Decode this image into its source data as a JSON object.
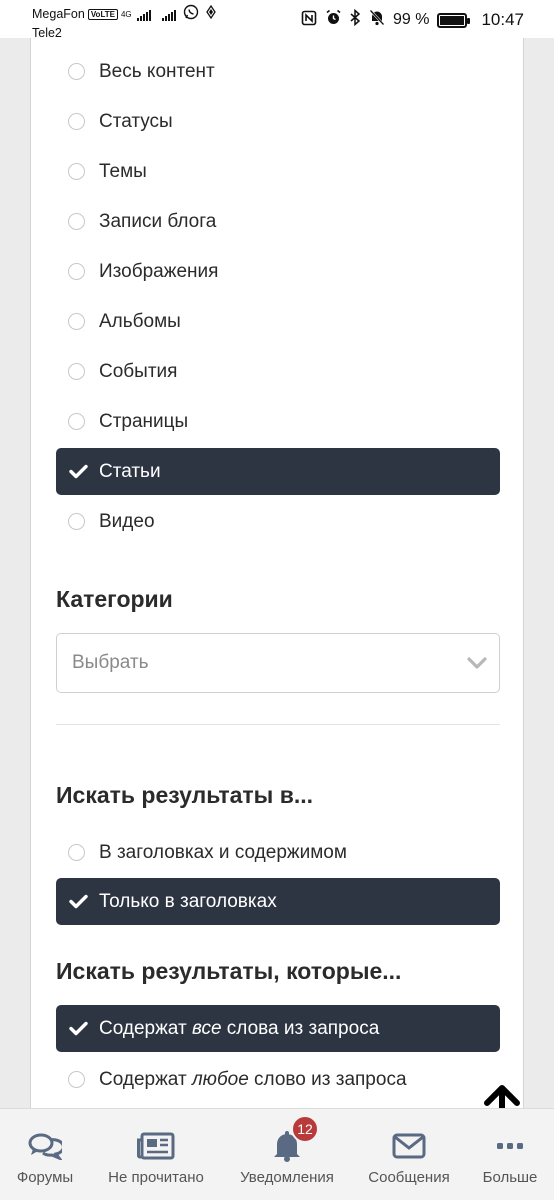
{
  "statusbar": {
    "carrier1": "MegaFon",
    "volte": "VoLTE",
    "network": "4G",
    "carrier2": "Tele2",
    "battery": "99 %",
    "time": "10:47"
  },
  "content_types": [
    {
      "label": "Весь контент",
      "selected": false
    },
    {
      "label": "Статусы",
      "selected": false
    },
    {
      "label": "Темы",
      "selected": false
    },
    {
      "label": "Записи блога",
      "selected": false
    },
    {
      "label": "Изображения",
      "selected": false
    },
    {
      "label": "Альбомы",
      "selected": false
    },
    {
      "label": "События",
      "selected": false
    },
    {
      "label": "Страницы",
      "selected": false
    },
    {
      "label": "Статьи",
      "selected": true
    },
    {
      "label": "Видео",
      "selected": false
    }
  ],
  "categories": {
    "heading": "Категории",
    "placeholder": "Выбрать"
  },
  "search_in": {
    "heading": "Искать результаты в...",
    "options": [
      {
        "label": "В заголовках и содержимом",
        "selected": false
      },
      {
        "label": "Только в заголовках",
        "selected": true
      }
    ]
  },
  "search_which": {
    "heading": "Искать результаты, которые...",
    "option1": {
      "before": "Содержат ",
      "em": "все",
      "after": " слова из запроса",
      "selected": true
    },
    "option2": {
      "before": "Содержат ",
      "em": "любое",
      "after": " слово из запроса",
      "selected": false
    }
  },
  "tabbar": {
    "forums": "Форумы",
    "unread": "Не прочитано",
    "notifications": "Уведомления",
    "notifications_badge": "12",
    "messages": "Сообщения",
    "more": "Больше"
  },
  "icons": [
    "chat-bubbles-icon",
    "newspaper-icon",
    "bell-icon",
    "envelope-icon",
    "more-dots-icon",
    "arrow-up-icon",
    "check-icon",
    "chevron-down-icon"
  ],
  "colors": {
    "selected_bg": "#2d3442",
    "badge": "#b83a3a",
    "panel": "#ffffff",
    "page_bg": "#ebebeb"
  }
}
